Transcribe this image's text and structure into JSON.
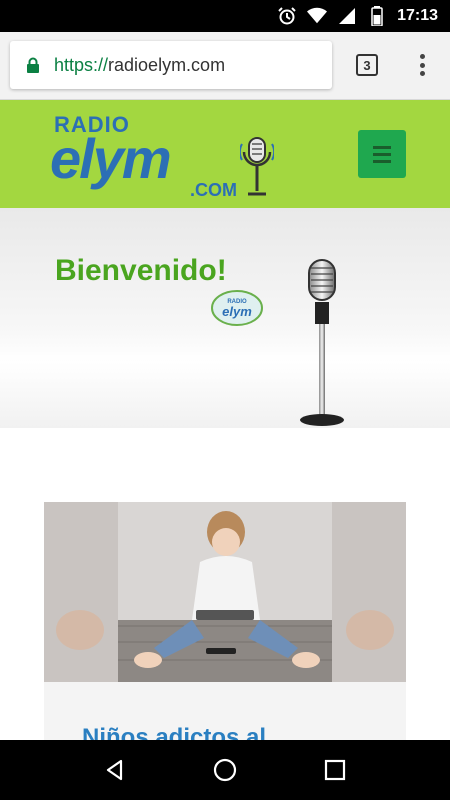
{
  "status_bar": {
    "time": "17:13",
    "icons": [
      "alarm-icon",
      "wifi-icon",
      "signal-icon",
      "battery-icon"
    ]
  },
  "browser": {
    "url_scheme": "https://",
    "url_host": "radioelym.com",
    "tab_count": "3",
    "secure": true
  },
  "site_header": {
    "logo_radio": "RADIO",
    "logo_main": "elym",
    "logo_com": ".COM",
    "menu_icon": "hamburger-icon",
    "background": "#a3d740",
    "menu_color": "#1fa84f"
  },
  "hero": {
    "title": "Bienvenido!",
    "title_color": "#4aa51f"
  },
  "article": {
    "title": "Niños adictos al",
    "title_color": "#2a7fc1"
  },
  "nav_bar": {
    "buttons": [
      "back-icon",
      "home-icon",
      "recents-icon"
    ]
  }
}
